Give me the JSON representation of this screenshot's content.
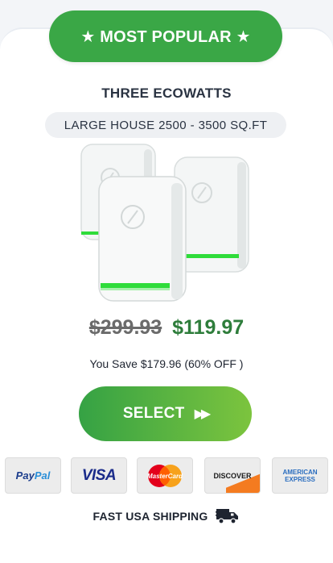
{
  "colors": {
    "accent_green": "#3aa746",
    "price_green": "#2e7d3b",
    "button_gradient_start": "#35a244",
    "button_gradient_end": "#7cc43e",
    "text_dark": "#2a3342"
  },
  "badge": {
    "label": "★ MOST POPULAR ★"
  },
  "product": {
    "title": "THREE ECOWATTS",
    "size_label": "LARGE HOUSE 2500 - 3500 SQ.FT",
    "image_icon": "three-ecowatt-devices-image",
    "old_price": "$299.93",
    "new_price": "$119.97",
    "savings": "You Save $179.96 (60% OFF )"
  },
  "cta": {
    "label": "SELECT",
    "icon": "double-chevron-right-icon"
  },
  "payments": {
    "paypal": {
      "part1": "Pay",
      "part2": "Pal"
    },
    "visa": "VISA",
    "mastercard": "MasterCard",
    "discover": "DISCOVER",
    "amex": {
      "line1": "AMERICAN",
      "line2": "EXPRESS"
    }
  },
  "shipping": {
    "label": "FAST USA SHIPPING",
    "icon": "truck-icon"
  }
}
